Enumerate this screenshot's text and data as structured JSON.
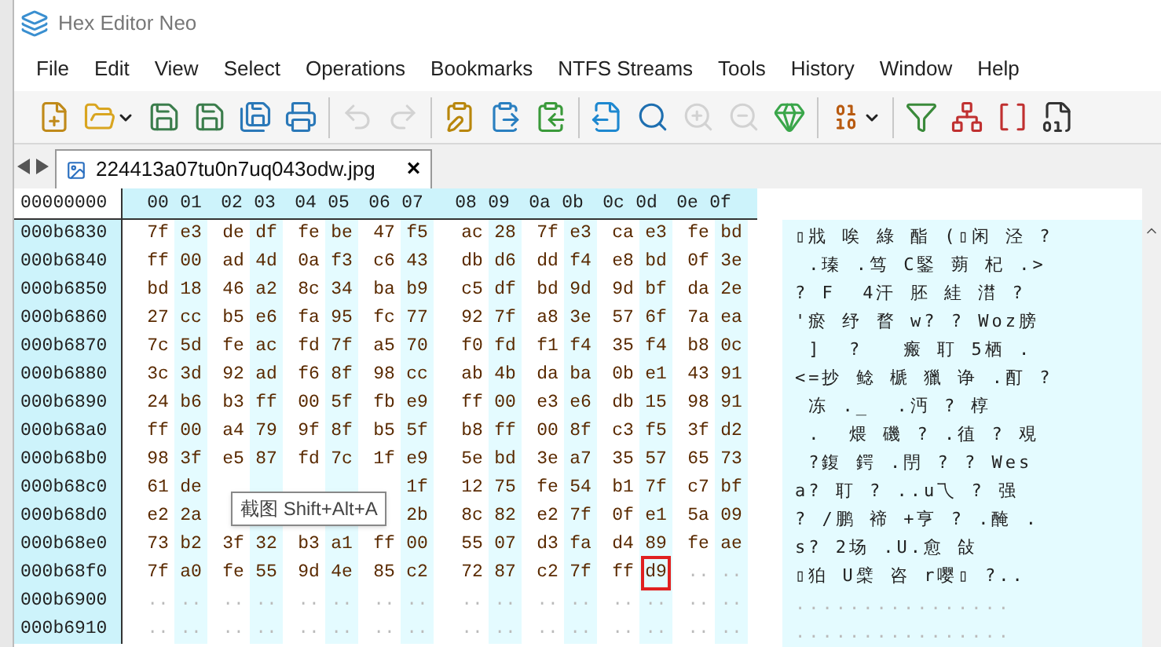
{
  "window": {
    "title": "Hex Editor Neo"
  },
  "menu": [
    "File",
    "Edit",
    "View",
    "Select",
    "Operations",
    "Bookmarks",
    "NTFS Streams",
    "Tools",
    "History",
    "Window",
    "Help"
  ],
  "toolbar": [
    {
      "kind": "button",
      "disabled": false
    },
    {
      "kind": "dropdown",
      "disabled": false
    },
    {
      "kind": "button",
      "disabled": false
    },
    {
      "kind": "button",
      "disabled": false
    },
    {
      "kind": "button",
      "disabled": false
    },
    {
      "kind": "button",
      "disabled": false
    },
    {
      "kind": "separator"
    },
    {
      "kind": "button",
      "disabled": true
    },
    {
      "kind": "button",
      "disabled": true
    },
    {
      "kind": "separator"
    },
    {
      "kind": "button",
      "disabled": false
    },
    {
      "kind": "button",
      "disabled": false
    },
    {
      "kind": "button",
      "disabled": false
    },
    {
      "kind": "separator"
    },
    {
      "kind": "button",
      "disabled": false
    },
    {
      "kind": "button",
      "disabled": false
    },
    {
      "kind": "button",
      "disabled": true
    },
    {
      "kind": "button",
      "disabled": true
    },
    {
      "kind": "button",
      "disabled": false
    },
    {
      "kind": "separator"
    },
    {
      "kind": "dropdown",
      "disabled": false
    },
    {
      "kind": "separator"
    },
    {
      "kind": "button",
      "disabled": false
    },
    {
      "kind": "button",
      "disabled": false
    },
    {
      "kind": "button",
      "disabled": false
    },
    {
      "kind": "button",
      "disabled": false
    }
  ],
  "tabs": [
    {
      "label": "224413a07tu0n7uq043odw.jpg",
      "selected": true,
      "close": "×"
    }
  ],
  "hex": {
    "offset_header": "00000000",
    "columns": [
      "00",
      "01",
      "02",
      "03",
      "04",
      "05",
      "06",
      "07",
      "08",
      "09",
      "0a",
      "0b",
      "0c",
      "0d",
      "0e",
      "0f"
    ],
    "rows": [
      {
        "address": "000b6830",
        "bytes": [
          "7f",
          "e3",
          "de",
          "df",
          "fe",
          "be",
          "47",
          "f5",
          "ac",
          "28",
          "7f",
          "e3",
          "ca",
          "e3",
          "fe",
          "bd"
        ],
        "text": "▯戕 唉 綠 酯 (▯闲 泾 ?"
      },
      {
        "address": "000b6840",
        "bytes": [
          "ff",
          "00",
          "ad",
          "4d",
          "0a",
          "f3",
          "c6",
          "43",
          "db",
          "d6",
          "dd",
          "f4",
          "e8",
          "bd",
          "0f",
          "3e"
        ],
        "text": " .瑧 .笃 C鋻 蒴 杞 .>"
      },
      {
        "address": "000b6850",
        "bytes": [
          "bd",
          "18",
          "46",
          "a2",
          "8c",
          "34",
          "ba",
          "b9",
          "c5",
          "df",
          "bd",
          "9d",
          "9d",
          "bf",
          "da",
          "2e"
        ],
        "text": "? F  4汗 胚 絓 澘 ?"
      },
      {
        "address": "000b6860",
        "bytes": [
          "27",
          "cc",
          "b5",
          "e6",
          "fa",
          "95",
          "fc",
          "77",
          "92",
          "7f",
          "a8",
          "3e",
          "57",
          "6f",
          "7a",
          "ea"
        ],
        "text": "'瘀 纾 瞀 w? ? Woz膀"
      },
      {
        "address": "000b6870",
        "bytes": [
          "7c",
          "5d",
          "fe",
          "ac",
          "fd",
          "7f",
          "a5",
          "70",
          "f0",
          "fd",
          "f1",
          "f4",
          "35",
          "f4",
          "b8",
          "0c"
        ],
        "text": " ]  ?   瘢 耵 5栖 ."
      },
      {
        "address": "000b6880",
        "bytes": [
          "3c",
          "3d",
          "92",
          "ad",
          "f6",
          "8f",
          "98",
          "cc",
          "ab",
          "4b",
          "da",
          "ba",
          "0b",
          "e1",
          "43",
          "91"
        ],
        "text": "<=抄 鲶 榹 獵 诤 .酊 ?"
      },
      {
        "address": "000b6890",
        "bytes": [
          "24",
          "b6",
          "b3",
          "ff",
          "00",
          "5f",
          "fb",
          "e9",
          "ff",
          "00",
          "e3",
          "e6",
          "db",
          "15",
          "98",
          "91"
        ],
        "text": " 冻 ._  .沔 ? 椁"
      },
      {
        "address": "000b68a0",
        "bytes": [
          "ff",
          "00",
          "a4",
          "79",
          "9f",
          "8f",
          "b5",
          "5f",
          "b8",
          "ff",
          "00",
          "8f",
          "c3",
          "f5",
          "3f",
          "d2"
        ],
        "text": " .  煨 磯 ? .徝 ? 覌"
      },
      {
        "address": "000b68b0",
        "bytes": [
          "98",
          "3f",
          "e5",
          "87",
          "fd",
          "7c",
          "1f",
          "e9",
          "5e",
          "bd",
          "3e",
          "a7",
          "35",
          "57",
          "65",
          "73"
        ],
        "text": " ?鍑 鍔 .閅 ? ? Wes"
      },
      {
        "address": "000b68c0",
        "bytes": [
          "61",
          "de"
        ],
        "bytes_after_tooltip": [
          "1f",
          "12",
          "75",
          "fe",
          "54",
          "b1",
          "7f",
          "c7",
          "bf"
        ],
        "text": "a? 耵 ? ..u乁 ? 强"
      },
      {
        "address": "000b68d0",
        "bytes": [
          "e2",
          "2a"
        ],
        "bytes_after_tooltip": [
          "2b",
          "8c",
          "82",
          "e2",
          "7f",
          "0f",
          "e1",
          "5a",
          "09"
        ],
        "text": "? /鹏 褅 +亨 ? .醃 ."
      },
      {
        "address": "000b68e0",
        "bytes": [
          "73",
          "b2",
          "3f",
          "32",
          "b3",
          "a1",
          "ff",
          "00",
          "55",
          "07",
          "d3",
          "fa",
          "d4",
          "89",
          "fe",
          "ae"
        ],
        "text": "s? 2场 .U.愈 敆"
      },
      {
        "address": "000b68f0",
        "bytes": [
          "7f",
          "a0",
          "fe",
          "55",
          "9d",
          "4e",
          "85",
          "c2",
          "72",
          "87",
          "c2",
          "7f",
          "ff",
          {
            "value": "d9",
            "selected": true
          },
          "..",
          ".."
        ],
        "text": "▯狛 U檗 咨 r嘤▯ ?.."
      },
      {
        "address": "000b6900",
        "bytes": [
          "..",
          "..",
          "..",
          "..",
          "..",
          "..",
          "..",
          "..",
          "..",
          "..",
          "..",
          "..",
          "..",
          "..",
          "..",
          ".."
        ],
        "text": "................"
      },
      {
        "address": "000b6910",
        "bytes": [
          "..",
          "..",
          "..",
          "..",
          "..",
          "..",
          "..",
          "..",
          "..",
          "..",
          "..",
          "..",
          "..",
          "..",
          "..",
          ".."
        ],
        "text": "................"
      }
    ]
  },
  "tooltip": {
    "text": "截图 Shift+Alt+A"
  }
}
